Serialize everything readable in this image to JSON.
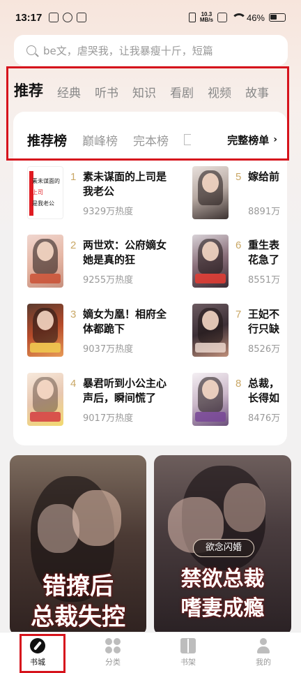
{
  "status_bar": {
    "time": "13:17",
    "net_speed_value": "10.3",
    "net_speed_unit": "MB/s",
    "battery": "46%"
  },
  "search": {
    "placeholder": "be文，虐哭我，让我暴瘦十斤，短篇"
  },
  "category_tabs": [
    "推荐",
    "经典",
    "听书",
    "知识",
    "看剧",
    "视频",
    "故事"
  ],
  "ranking": {
    "tabs": [
      "推荐榜",
      "巅峰榜",
      "完本榜"
    ],
    "full_list_label": "完整榜单",
    "books": [
      {
        "rank": "1",
        "title_l1": "素未谋面的上司是",
        "title_l2": "我老公",
        "heat": "9329万热度"
      },
      {
        "rank": "2",
        "title_l1": "两世欢：公府嫡女",
        "title_l2": "她是真的狂",
        "heat": "9255万热度"
      },
      {
        "rank": "3",
        "title_l1": "嫡女为凰！相府全",
        "title_l2": "体都跪下",
        "heat": "9037万热度"
      },
      {
        "rank": "4",
        "title_l1": "暴君听到小公主心",
        "title_l2": "声后，瞬间慌了",
        "heat": "9017万热度"
      },
      {
        "rank": "5",
        "title_l1": "嫁给前",
        "title_l2": "",
        "heat": "8891万"
      },
      {
        "rank": "6",
        "title_l1": "重生表",
        "title_l2": "花急了",
        "heat": "8551万"
      },
      {
        "rank": "7",
        "title_l1": "王妃不",
        "title_l2": "行只缺",
        "heat": "8526万"
      },
      {
        "rank": "8",
        "title_l1": "总裁，",
        "title_l2": "长得如",
        "heat": "8476万"
      }
    ],
    "cover1_text": {
      "l1": "素未谋面的",
      "l2": "上司",
      "l3": "是我老公"
    }
  },
  "promos": [
    {
      "title_l1": "错撩后",
      "title_l2": "总裁失控"
    },
    {
      "badge": "欲念闪婚",
      "title_l1": "禁欲总裁",
      "title_l2": "嗜妻成瘾"
    }
  ],
  "bottom_nav": [
    {
      "label": "书城",
      "icon": "compass-icon"
    },
    {
      "label": "分类",
      "icon": "grid-icon"
    },
    {
      "label": "书架",
      "icon": "book-icon"
    },
    {
      "label": "我的",
      "icon": "user-icon"
    }
  ],
  "colors": {
    "highlight": "#d6131c",
    "rank_number": "#c9a765"
  }
}
